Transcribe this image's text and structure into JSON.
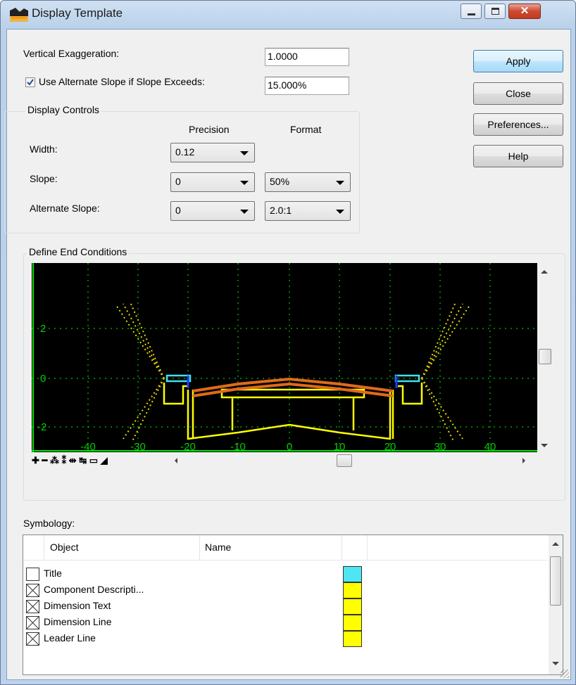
{
  "window": {
    "title": "Display Template"
  },
  "fields": {
    "vertical_exaggeration_label": "Vertical Exaggeration:",
    "vertical_exaggeration_value": "1.0000",
    "alt_slope_label": "Use Alternate Slope if Slope Exceeds:",
    "alt_slope_value": "15.000%",
    "alt_slope_checked": true
  },
  "buttons": {
    "apply": "Apply",
    "close": "Close",
    "preferences": "Preferences...",
    "help": "Help"
  },
  "display_controls": {
    "title": "Display Controls",
    "col_precision": "Precision",
    "col_format": "Format",
    "rows": [
      {
        "label": "Width:",
        "precision": "0.12",
        "format": ""
      },
      {
        "label": "Slope:",
        "precision": "0",
        "format": "50%"
      },
      {
        "label": "Alternate Slope:",
        "precision": "0",
        "format": "2.0:1"
      }
    ]
  },
  "end_conditions": {
    "title": "Define End Conditions",
    "y_ticks": [
      "2",
      "0",
      "-2"
    ],
    "x_ticks": [
      "-40",
      "-30",
      "-20",
      "-10",
      "0",
      "10",
      "20",
      "30",
      "40"
    ],
    "toolbar_icons": [
      "zoom-in-icon",
      "zoom-out-icon",
      "zoom-extents-icon",
      "zoom-window-icon",
      "pan-icon",
      "move-icon",
      "fit-icon",
      "terrain-icon"
    ]
  },
  "symbology": {
    "label": "Symbology:",
    "col_object": "Object",
    "col_name": "Name",
    "rows": [
      {
        "object": "Title",
        "checked": false,
        "color": "#4ee6f2"
      },
      {
        "object": "Component Descripti...",
        "checked": true,
        "color": "#ffff00"
      },
      {
        "object": "Dimension Text",
        "checked": true,
        "color": "#ffff00"
      },
      {
        "object": "Dimension Line",
        "checked": true,
        "color": "#ffff00"
      },
      {
        "object": "Leader Line",
        "checked": true,
        "color": "#ffff00"
      }
    ]
  },
  "colors": {
    "grid": "#00c000",
    "axis": "#00e000",
    "template_yellow": "#ffff00",
    "pavement_orange": "#e06a1a",
    "curb_cyan": "#40e0f0"
  }
}
